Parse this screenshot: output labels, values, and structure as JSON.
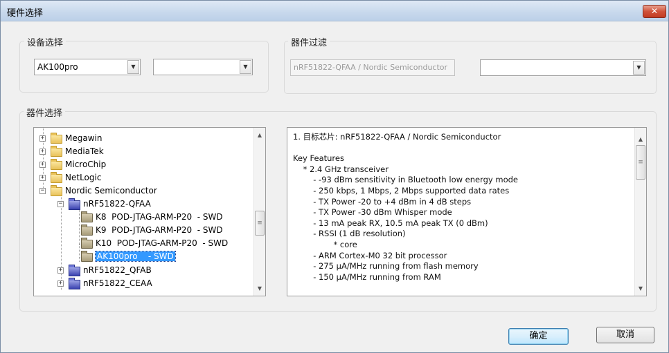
{
  "window": {
    "title": "硬件选择",
    "close_glyph": "✕"
  },
  "device_group": {
    "label": "设备选择",
    "device_combo": {
      "value": "AK100pro"
    },
    "second_combo": {
      "value": ""
    }
  },
  "filter_group": {
    "label": "器件过滤",
    "filter_field": {
      "value": "nRF51822-QFAA / Nordic Semiconductor"
    },
    "filter_combo": {
      "value": ""
    }
  },
  "select_group": {
    "label": "器件选择"
  },
  "tree": {
    "items": [
      {
        "label": "Megawin",
        "icon": "folder-icon",
        "expander": "+"
      },
      {
        "label": "MediaTek",
        "icon": "folder-icon",
        "expander": "+"
      },
      {
        "label": "MicroChip",
        "icon": "folder-icon",
        "expander": "+"
      },
      {
        "label": "NetLogic",
        "icon": "folder-icon",
        "expander": "+"
      },
      {
        "label": "Nordic Semiconductor",
        "icon": "folder-icon",
        "expander": "−"
      },
      {
        "label": "nRF51822-QFAA",
        "icon": "chip-icon",
        "expander": "−"
      },
      {
        "label": "K8  POD-JTAG-ARM-P20  - SWD",
        "icon": "adapter-icon"
      },
      {
        "label": "K9  POD-JTAG-ARM-P20  - SWD",
        "icon": "adapter-icon"
      },
      {
        "label": "K10  POD-JTAG-ARM-P20  - SWD",
        "icon": "adapter-icon"
      },
      {
        "label": "AK100pro    - SWD",
        "icon": "adapter-open-icon",
        "selected": true
      },
      {
        "label": "nRF51822_QFAB",
        "icon": "chip-icon",
        "expander": "+"
      },
      {
        "label": "nRF51822_CEAA",
        "icon": "chip-icon",
        "expander": "+"
      }
    ]
  },
  "info_panel": {
    "text": "1. 目标芯片: nRF51822-QFAA / Nordic Semiconductor\n\nKey Features\n    * 2.4 GHz transceiver\n        - -93 dBm sensitivity in Bluetooth low energy mode\n        - 250 kbps, 1 Mbps, 2 Mbps supported data rates\n        - TX Power -20 to +4 dBm in 4 dB steps\n        - TX Power -30 dBm Whisper mode\n        - 13 mA peak RX, 10.5 mA peak TX (0 dBm)\n        - RSSI (1 dB resolution)\n                * core\n        - ARM Cortex-M0 32 bit processor\n        - 275 µA/MHz running from flash memory\n        - 150 µA/MHz running from RAM"
  },
  "buttons": {
    "ok": "确定",
    "cancel": "取消"
  },
  "scroll_glyphs": {
    "up": "▲",
    "down": "▼",
    "grip": "≡",
    "combo_arrow": "▼"
  }
}
